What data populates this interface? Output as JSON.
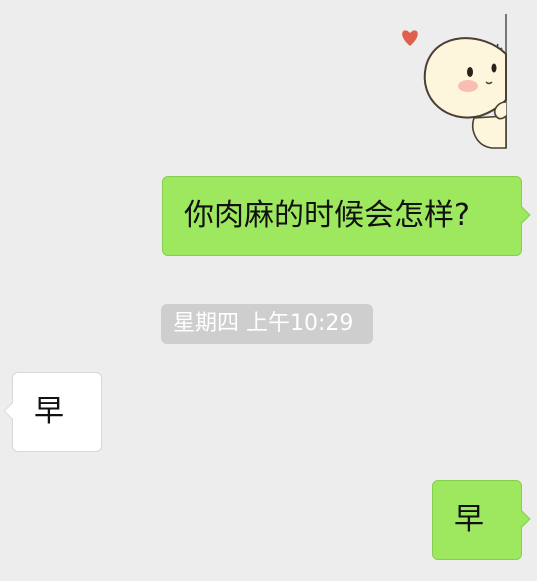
{
  "chat": {
    "sticker": {
      "icon": "cute-character-peeking-sticker",
      "colors": {
        "face": "#fdf6dc",
        "blush": "#f6a6a0",
        "heart": "#e0604e",
        "wall": "#777777"
      }
    },
    "messages": [
      {
        "direction": "outgoing",
        "text": "你肉麻的时候会怎样?"
      },
      {
        "direction": "incoming",
        "text": "早"
      },
      {
        "direction": "outgoing",
        "text": "早"
      }
    ],
    "timestamp": "星期四 上午10:29"
  },
  "colors": {
    "background": "#ededed",
    "outgoing_bubble": "#9ee85f",
    "incoming_bubble": "#ffffff",
    "timestamp_bg": "#cecece",
    "timestamp_text": "#ffffff"
  }
}
